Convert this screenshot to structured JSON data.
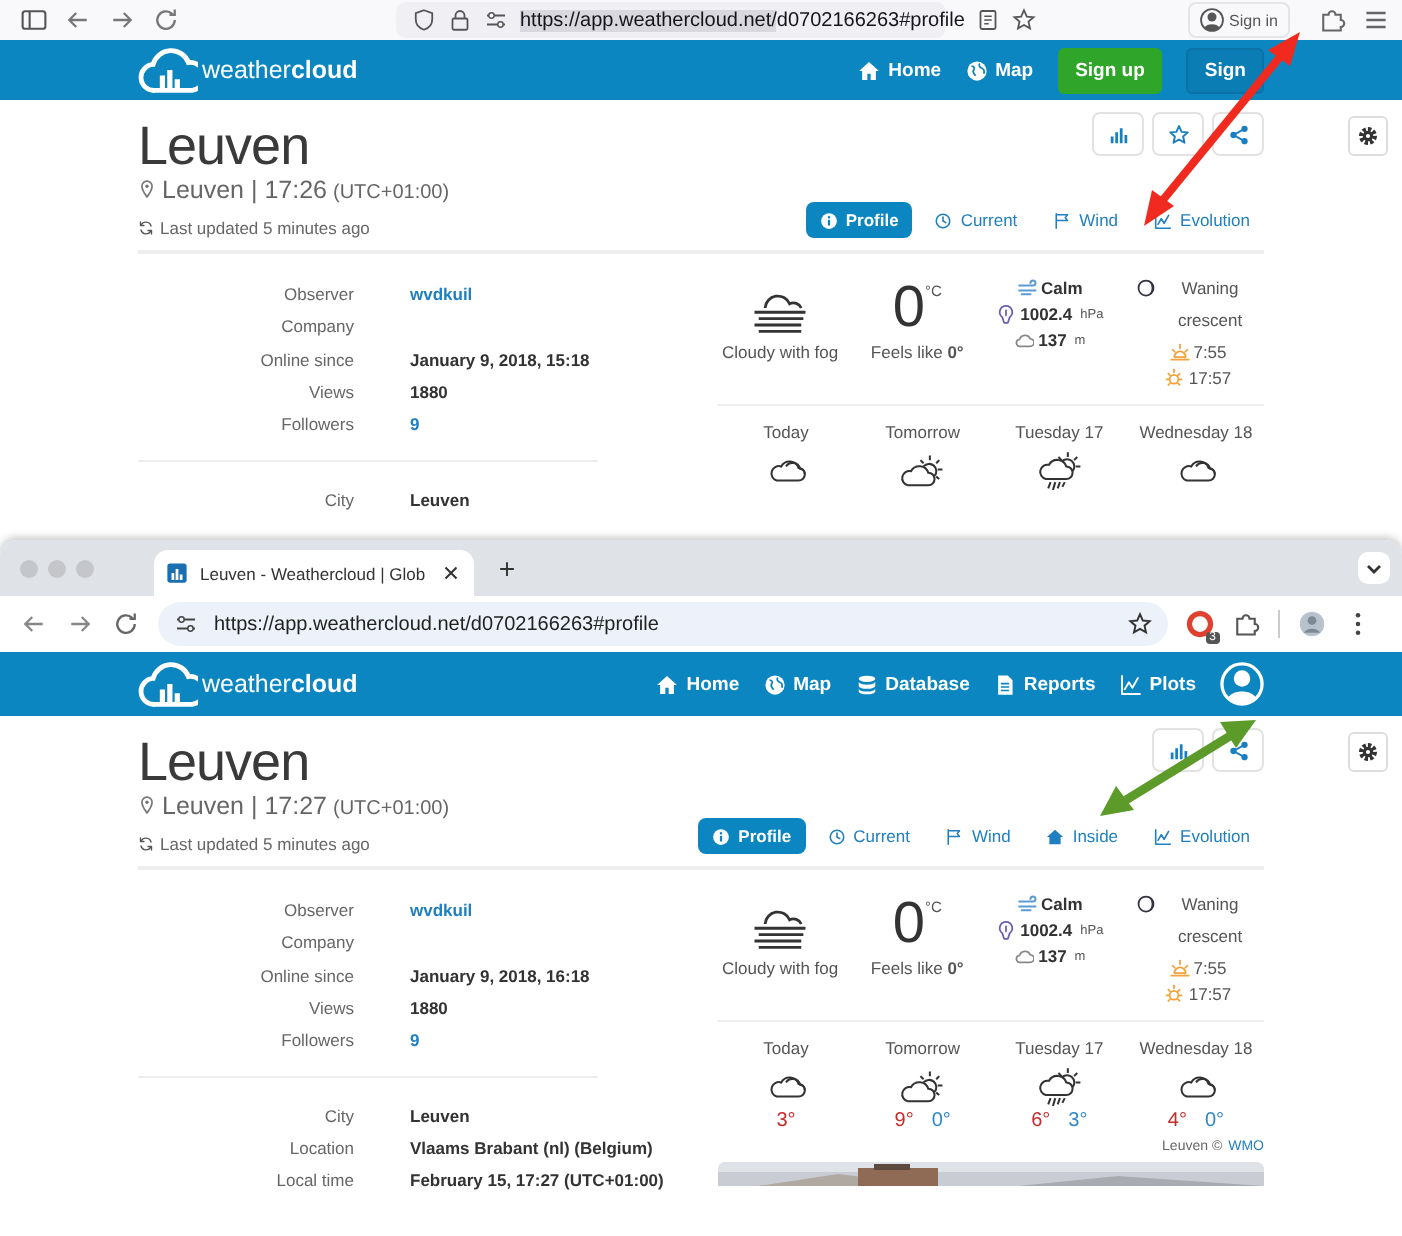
{
  "windows": [
    {
      "kind": "firefox",
      "logo": "weather**cloud**",
      "url_selected": "https://app.weathercloud.net/",
      "url_rest": "d0702166263#profile",
      "account_button": "Sign in",
      "nav": [
        {
          "kind": "home",
          "label": "Home"
        },
        {
          "kind": "map",
          "label": "Map"
        },
        {
          "kind": "signup",
          "label": "Sign up"
        },
        {
          "kind": "signin",
          "label": "Sign"
        }
      ],
      "page": {
        "title": "Leuven",
        "location": "Leuven | 17:26",
        "utc": "(UTC+01:00)",
        "updated": "Last updated 5 minutes ago",
        "actions": [
          {
            "kind": "chart"
          },
          {
            "kind": "star"
          },
          {
            "kind": "share"
          }
        ],
        "tabs": [
          {
            "kind": "profile",
            "label": "Profile",
            "selected": true
          },
          {
            "kind": "current",
            "label": "Current",
            "selected": false
          },
          {
            "kind": "wind",
            "label": "Wind",
            "selected": false
          },
          {
            "kind": "evolution",
            "label": "Evolution",
            "selected": false
          }
        ],
        "info_sections": [
          [
            {
              "label": "Observer",
              "value": "wvdkuil",
              "kind": "link"
            },
            {
              "label": "Company"
            },
            {
              "label": "Online since",
              "value": "January 9, 2018, 15:18",
              "kind": "text"
            },
            {
              "label": "Views",
              "value": "1880",
              "kind": "text"
            },
            {
              "label": "Followers",
              "value": "9",
              "kind": "link"
            }
          ],
          [
            {
              "label": "City",
              "value": "Leuven",
              "kind": "text"
            }
          ]
        ],
        "current": {
          "kind": "fog",
          "condition": "Cloudy with fog",
          "temp": "0",
          "unit": "°C",
          "feels_label": "Feels like",
          "feels": "0°",
          "wind": "Calm",
          "pressure": "1002.4",
          "pressure_unit": "hPa",
          "cloud_base": "137",
          "cloud_unit": "m",
          "moon": "Waning crescent",
          "sunrise": "7:55",
          "sunset": "17:57"
        },
        "forecast": [
          {
            "day": "Today",
            "kind": "cloudy"
          },
          {
            "day": "Tomorrow",
            "kind": "partly"
          },
          {
            "day": "Tuesday 17",
            "kind": "rain"
          },
          {
            "day": "Wednesday 18",
            "kind": "cloudy"
          }
        ]
      }
    },
    {
      "kind": "chrome",
      "logo": "weather**cloud**",
      "tab_title": "Leuven - Weathercloud | Glob",
      "url": "https://app.weathercloud.net/d0702166263#profile",
      "extension_badge": "3",
      "nav": [
        {
          "kind": "home",
          "label": "Home"
        },
        {
          "kind": "map",
          "label": "Map"
        },
        {
          "kind": "database",
          "label": "Database"
        },
        {
          "kind": "reports",
          "label": "Reports"
        },
        {
          "kind": "plots",
          "label": "Plots"
        },
        {
          "kind": "account"
        }
      ],
      "page": {
        "title": "Leuven",
        "location": "Leuven | 17:27",
        "utc": "(UTC+01:00)",
        "updated": "Last updated 5 minutes ago",
        "actions": [
          {
            "kind": "chart"
          },
          {
            "kind": "share"
          }
        ],
        "tabs": [
          {
            "kind": "profile",
            "label": "Profile",
            "selected": true
          },
          {
            "kind": "current",
            "label": "Current",
            "selected": false
          },
          {
            "kind": "wind",
            "label": "Wind",
            "selected": false
          },
          {
            "kind": "inside",
            "label": "Inside",
            "selected": false
          },
          {
            "kind": "evolution",
            "label": "Evolution",
            "selected": false
          }
        ],
        "info_sections": [
          [
            {
              "label": "Observer",
              "value": "wvdkuil",
              "kind": "link"
            },
            {
              "label": "Company"
            },
            {
              "label": "Online since",
              "value": "January 9, 2018, 16:18",
              "kind": "text"
            },
            {
              "label": "Views",
              "value": "1880",
              "kind": "text"
            },
            {
              "label": "Followers",
              "value": "9",
              "kind": "link"
            }
          ],
          [
            {
              "label": "City",
              "value": "Leuven",
              "kind": "text"
            },
            {
              "label": "Location",
              "value": "Vlaams Brabant (nl) (Belgium)",
              "kind": "text"
            },
            {
              "label": "Local time",
              "value": "February 15, 17:27 (UTC+01:00)",
              "kind": "text"
            }
          ]
        ],
        "current": {
          "kind": "fog",
          "condition": "Cloudy with fog",
          "temp": "0",
          "unit": "°C",
          "feels_label": "Feels like",
          "feels": "0°",
          "wind": "Calm",
          "pressure": "1002.4",
          "pressure_unit": "hPa",
          "cloud_base": "137",
          "cloud_unit": "m",
          "moon": "Waning crescent",
          "sunrise": "7:55",
          "sunset": "17:57"
        },
        "forecast": [
          {
            "day": "Today",
            "kind": "cloudy",
            "high": "3°"
          },
          {
            "day": "Tomorrow",
            "kind": "partly",
            "high": "9°",
            "low": "0°"
          },
          {
            "day": "Tuesday 17",
            "kind": "rain",
            "high": "6°",
            "low": "3°"
          },
          {
            "day": "Wednesday 18",
            "kind": "cloudy",
            "high": "4°",
            "low": "0°"
          }
        ],
        "credit_text": "Leuven ©",
        "credit_link": "WMO",
        "photo": {
          "kind": "picture"
        }
      }
    }
  ]
}
